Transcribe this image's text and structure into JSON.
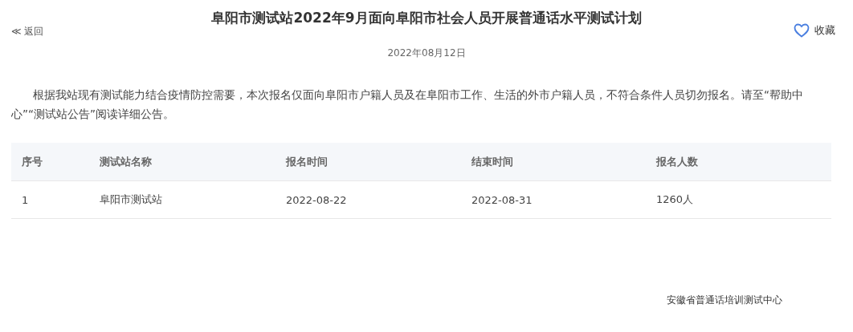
{
  "header": {
    "back": "≪ 返回",
    "title": "阜阳市测试站2022年9月面向阜阳市社会人员开展普通话水平测试计划",
    "favorite": {
      "label": "收藏",
      "selected": false
    },
    "date": "2022年08月12日"
  },
  "notice": "根据我站现有测试能力结合疫情防控需要，本次报名仅面向阜阳市户籍人员及在阜阳市工作、生活的外市户籍人员，不符合条件人员切勿报名。请至“帮助中心”“测试站公告”阅读详细公告。",
  "table": {
    "columns": [
      "序号",
      "测试站名称",
      "报名时间",
      "结束时间",
      "报名人数"
    ],
    "rows": [
      [
        "1",
        "阜阳市测试站",
        "2022-08-22",
        "2022-08-31",
        "1260人"
      ]
    ]
  },
  "footer": "安徽省普通话培训测试中心"
}
